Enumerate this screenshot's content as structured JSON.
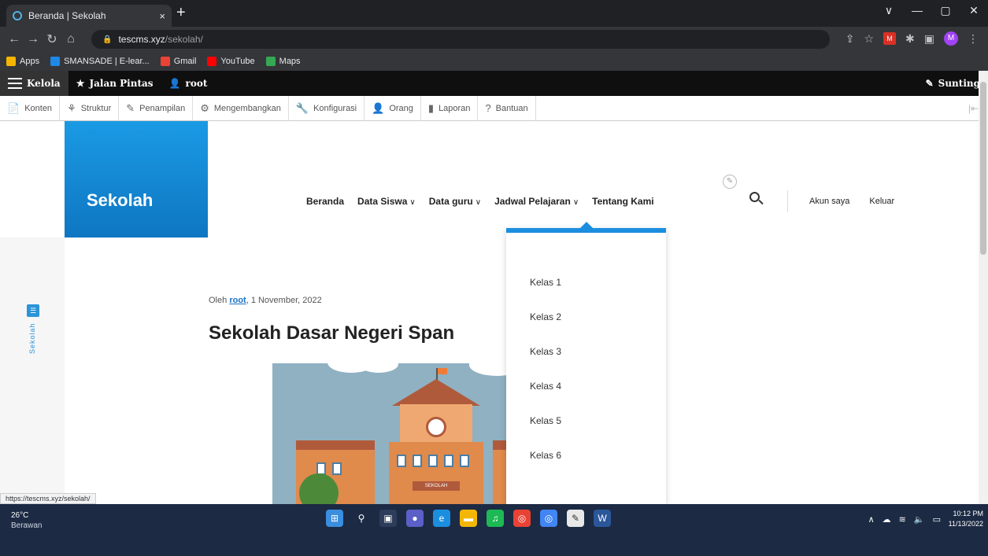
{
  "browser": {
    "tab_title": "Beranda | Sekolah",
    "tab_close": "×",
    "new_tab": "+",
    "url_host": "tescms.xyz",
    "url_path": "/sekolah/",
    "profile_initial": "M",
    "window_controls": [
      "∨",
      "—",
      "▢",
      "✕"
    ]
  },
  "bookmarks": [
    {
      "label": "Apps",
      "color": "#f4b400"
    },
    {
      "label": "SMANSADE | E-lear...",
      "color": "#1e88e5"
    },
    {
      "label": "Gmail",
      "color": "#ea4335"
    },
    {
      "label": "YouTube",
      "color": "#ff0000"
    },
    {
      "label": "Maps",
      "color": "#34a853"
    }
  ],
  "admin_toolbar": {
    "manage": "Kelola",
    "shortcuts": "Jalan Pintas",
    "user": "root",
    "edit": "Sunting"
  },
  "admin_menu": [
    {
      "label": "Konten",
      "icon": "📄"
    },
    {
      "label": "Struktur",
      "icon": "⚘"
    },
    {
      "label": "Penampilan",
      "icon": "✎"
    },
    {
      "label": "Mengembangkan",
      "icon": "⚙"
    },
    {
      "label": "Konfigurasi",
      "icon": "🔧"
    },
    {
      "label": "Orang",
      "icon": "👤"
    },
    {
      "label": "Laporan",
      "icon": "▮"
    },
    {
      "label": "Bantuan",
      "icon": "?"
    }
  ],
  "site": {
    "name": "Sekolah",
    "side_label": "Sekolah",
    "nav": [
      {
        "label": "Beranda",
        "has_dropdown": false
      },
      {
        "label": "Data Siswa",
        "has_dropdown": true
      },
      {
        "label": "Data guru",
        "has_dropdown": true
      },
      {
        "label": "Jadwal Pelajaran",
        "has_dropdown": true
      },
      {
        "label": "Tentang Kami",
        "has_dropdown": false
      }
    ],
    "account_nav": [
      "Akun saya",
      "Keluar"
    ],
    "dropdown_items": [
      "Kelas 1",
      "Kelas 2",
      "Kelas 3",
      "Kelas 4",
      "Kelas 5",
      "Kelas 6"
    ],
    "accent_color": "#1b8ee0"
  },
  "article": {
    "meta_prefix": "Oleh",
    "author": "root",
    "date": ", 1 November, 2022",
    "title": "Sekolah Dasar Negeri Span",
    "sign_text": "SEKOLAH"
  },
  "status_url": "https://tescms.xyz/sekolah/",
  "taskbar": {
    "temperature": "26°C",
    "weather": "Berawan",
    "time": "10:12 PM",
    "date": "11/13/2022"
  }
}
